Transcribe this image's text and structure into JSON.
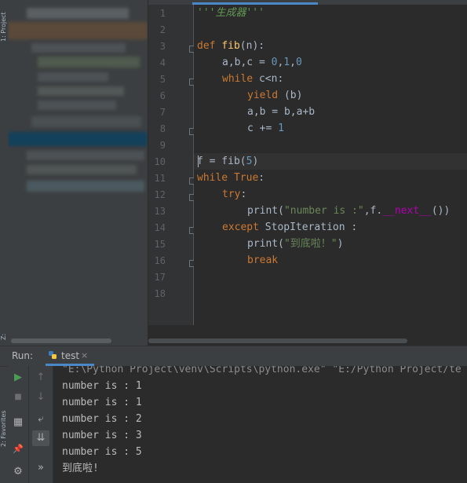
{
  "side_stripes": {
    "project": "1: Project",
    "structure": "Z: Structure",
    "favorites": "2: Favorites"
  },
  "editor": {
    "line_numbers": [
      "1",
      "2",
      "3",
      "4",
      "5",
      "6",
      "7",
      "8",
      "9",
      "10",
      "11",
      "12",
      "13",
      "14",
      "15",
      "16",
      "17",
      "18"
    ],
    "code": {
      "l1_doc": "'''生成器'''",
      "l3_def": "def ",
      "l3_name": "fib",
      "l3_rest": "(n):",
      "l4_a": "a,b,c = ",
      "l4_n0": "0",
      "l4_c1": ",",
      "l4_n1": "1",
      "l4_c2": ",",
      "l4_n2": "0",
      "l5_kw": "while ",
      "l5_rest": "c<n:",
      "l6_kw": "yield ",
      "l6_rest": "(b)",
      "l7": "a,b = b,a+b",
      "l8_a": "c += ",
      "l8_n": "1",
      "l10_a": "f = fib(",
      "l10_n": "5",
      "l10_b": ")",
      "l11_kw1": "while ",
      "l11_kw2": "True",
      "l11_rest": ":",
      "l12_kw": "try",
      "l12_rest": ":",
      "l13_a": "print(",
      "l13_str": "\"number is :\"",
      "l13_b": ",f.",
      "l13_magic": "__next__",
      "l13_c": "())",
      "l14_kw": "except ",
      "l14_rest": "StopIteration :",
      "l15_a": "print(",
      "l15_str": "\"到底啦！\"",
      "l15_b": ")",
      "l16_kw": "break"
    }
  },
  "run": {
    "label": "Run:",
    "tab_label": "test",
    "tab_close": "×",
    "console": [
      "\"E:\\Python Project\\venv\\Scripts\\python.exe\" \"E:/Python Project/te",
      "number is : 1",
      "number is : 1",
      "number is : 2",
      "number is : 3",
      "number is : 5",
      "到底啦!"
    ],
    "toolbar": {
      "rerun_icon": "▶",
      "stop_icon": "■",
      "up_icon": "↑",
      "down_icon": "↓",
      "layout_icon": "▦",
      "soft_wrap_icon": "⤶",
      "pin_icon": "📌",
      "scroll_end_icon": "⇊",
      "more_icon": "»",
      "settings_icon": "⚙"
    }
  },
  "colors": {
    "keyword": "#cc7832",
    "function": "#ffc66d",
    "number": "#6897bb",
    "string": "#6a8759",
    "accent": "#4a88c7"
  }
}
